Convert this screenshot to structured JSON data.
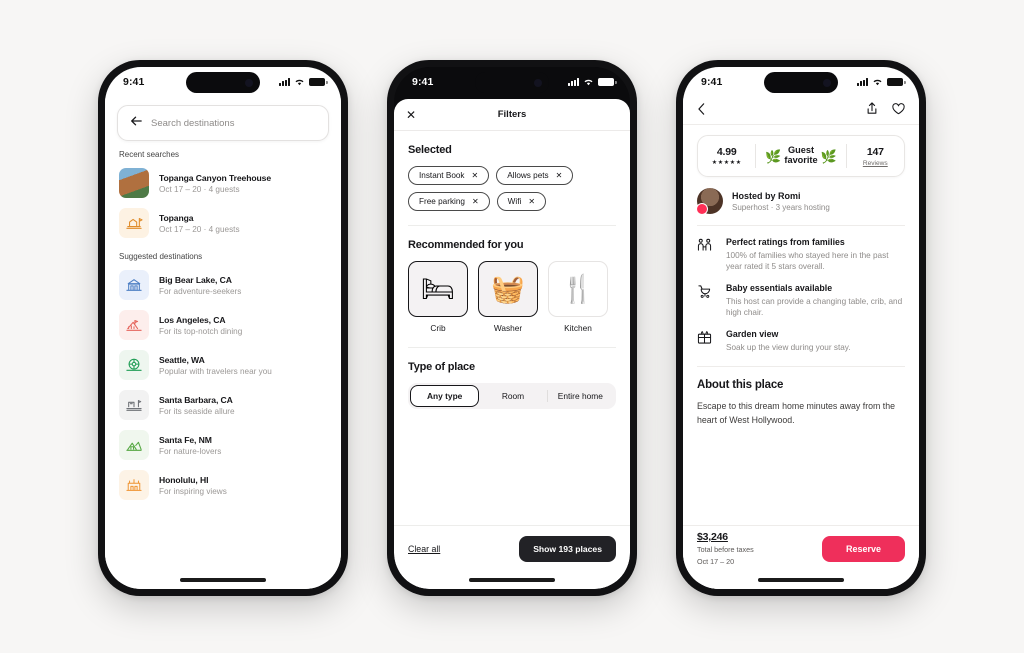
{
  "colors": {
    "background": "#f7f6f5",
    "accent": "#ef2f5b",
    "dark": "#222226",
    "frame": "#111113"
  },
  "phone1": {
    "status": {
      "time": "9:41",
      "signal_icon": "signal-icon",
      "wifi_icon": "wifi-icon",
      "battery_icon": "battery-icon"
    },
    "search": {
      "back_icon": "back-arrow-icon",
      "placeholder": "Search destinations",
      "value": ""
    },
    "recent_title": "Recent searches",
    "recent": [
      {
        "title": "Topanga Canyon Treehouse",
        "sub": "Oct 17 – 20 · 4 guests",
        "icon": "treehouse-photo",
        "glyph": "🏡",
        "bg": "#cfe0d7"
      },
      {
        "title": "Topanga",
        "sub": "Oct 17 – 20 · 4 guests",
        "icon": "map-pin-icon",
        "glyph": "🏘️",
        "bg": "#fdf2e3"
      }
    ],
    "suggested_title": "Suggested destinations",
    "suggested": [
      {
        "title": "Big Bear Lake, CA",
        "sub": "For adventure-seekers",
        "icon": "cabin-icon",
        "glyph": "🏛️",
        "bg": "#eaf0fb"
      },
      {
        "title": "Los Angeles, CA",
        "sub": "For its top-notch dining",
        "icon": "city-icon",
        "glyph": "🏙️",
        "bg": "#fdeeec"
      },
      {
        "title": "Seattle, WA",
        "sub": "Popular with travelers near you",
        "icon": "ferris-wheel-icon",
        "glyph": "🎡",
        "bg": "#eef6ef"
      },
      {
        "title": "Santa Barbara, CA",
        "sub": "For its seaside allure",
        "icon": "pier-icon",
        "glyph": "🏭",
        "bg": "#f2f2f2"
      },
      {
        "title": "Santa Fe, NM",
        "sub": "For nature-lovers",
        "icon": "mountain-icon",
        "glyph": "⛺",
        "bg": "#f0f7ee"
      },
      {
        "title": "Honolulu, HI",
        "sub": "For inspiring views",
        "icon": "palace-icon",
        "glyph": "🏰",
        "bg": "#fdf3e6"
      }
    ]
  },
  "phone2": {
    "status": {
      "time": "9:41",
      "signal_icon": "signal-icon",
      "wifi_icon": "wifi-icon",
      "battery_icon": "battery-icon"
    },
    "header": {
      "close_icon": "close-icon",
      "title": "Filters"
    },
    "selected": {
      "heading": "Selected",
      "chips": [
        {
          "label": "Instant Book",
          "remove_icon": "remove-chip-icon"
        },
        {
          "label": "Allows pets",
          "remove_icon": "remove-chip-icon"
        },
        {
          "label": "Free parking",
          "remove_icon": "remove-chip-icon"
        },
        {
          "label": "Wifi",
          "remove_icon": "remove-chip-icon"
        }
      ]
    },
    "recommended": {
      "heading": "Recommended for you",
      "cards": [
        {
          "label": "Crib",
          "icon": "crib-icon",
          "glyph": "🛏️",
          "selected": true
        },
        {
          "label": "Washer",
          "icon": "washer-icon",
          "glyph": "🧺",
          "selected": true
        },
        {
          "label": "Kitchen",
          "icon": "kitchen-utensils-icon",
          "glyph": "🍴",
          "selected": false
        }
      ]
    },
    "type_of_place": {
      "heading": "Type of place",
      "options": [
        "Any type",
        "Room",
        "Entire home"
      ],
      "selected": "Any type"
    },
    "footer": {
      "clear_all": "Clear all",
      "show_button": "Show 193 places"
    }
  },
  "phone3": {
    "status": {
      "time": "9:41",
      "signal_icon": "signal-icon",
      "wifi_icon": "wifi-icon",
      "battery_icon": "battery-icon"
    },
    "nav": {
      "back_icon": "back-chevron-icon",
      "share_icon": "share-icon",
      "favorite_icon": "heart-icon"
    },
    "rating": {
      "score": "4.99",
      "stars": "★★★★★",
      "badge": "Guest\nfavorite",
      "badge_line1": "Guest",
      "badge_line2": "favorite",
      "laurel_left": "🌿",
      "laurel_right": "🌿",
      "reviews_count": "147",
      "reviews_label": "Reviews"
    },
    "host": {
      "name": "Hosted by Romi",
      "meta": "Superhost · 3 years hosting",
      "avatar_icon": "host-avatar",
      "badge_icon": "superhost-badge-icon"
    },
    "features": [
      {
        "icon": "family-rating-icon",
        "glyph": "👪",
        "title": "Perfect ratings from families",
        "desc": "100% of families who stayed here in the past year rated it 5 stars overall."
      },
      {
        "icon": "stroller-icon",
        "glyph": "🛝",
        "title": "Baby essentials available",
        "desc": "This host can provide a changing table, crib, and high chair."
      },
      {
        "icon": "garden-view-icon",
        "glyph": "🪴",
        "title": "Garden view",
        "desc": "Soak up the view during your stay."
      }
    ],
    "about": {
      "heading": "About this place",
      "text": "Escape to this dream home minutes away from the heart of West Hollywood."
    },
    "footer": {
      "price": "$3,246",
      "price_sub": "Total before taxes",
      "dates": "Oct 17 – 20",
      "reserve_button": "Reserve"
    }
  }
}
